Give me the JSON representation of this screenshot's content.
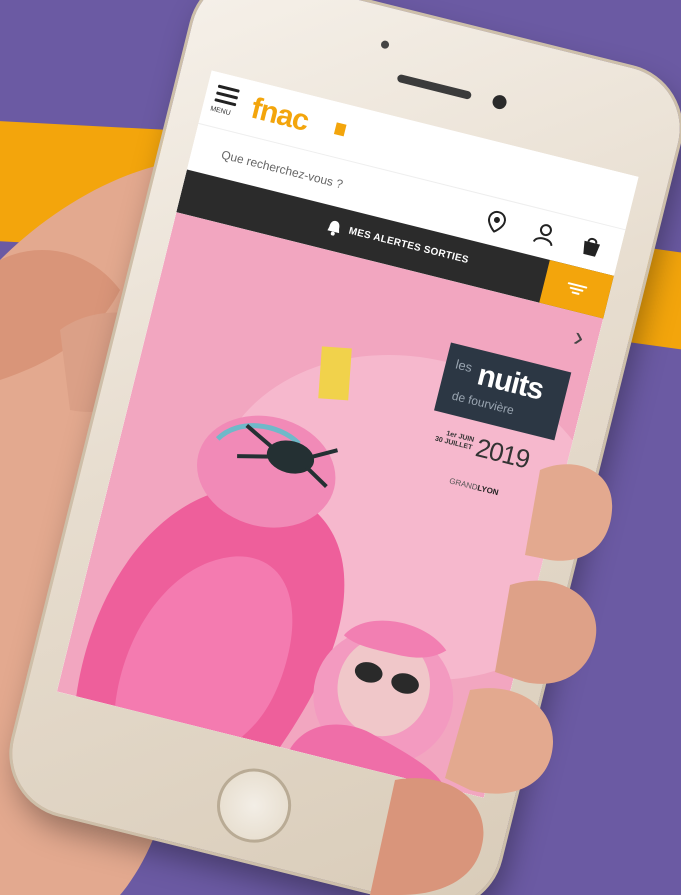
{
  "app": {
    "logo_text": "fnac",
    "menu_label": "MENU",
    "search_placeholder": "Que recherchez-vous ?",
    "alert_label": "MES ALERTES SORTIES"
  },
  "banner": {
    "les": "les",
    "title": "nuits",
    "subtitle": "de fourvière",
    "dates_top": "1er JUIN",
    "dates_bottom": "30 JUILLET",
    "year": "2019",
    "venue_prefix": "GRAND",
    "venue_city": "LYON"
  },
  "icons": {
    "menu": "hamburger-icon",
    "location": "location-pin-icon",
    "account": "user-icon",
    "cart": "shopping-bag-icon",
    "alert": "bell-icon",
    "filter": "filter-icon",
    "next": "chevron-right-icon"
  },
  "colors": {
    "background": "#6b5aa3",
    "brand_accent": "#f3a50c",
    "alert_bar": "#2b2b2b",
    "hero_pink": "#f2a6c0"
  }
}
